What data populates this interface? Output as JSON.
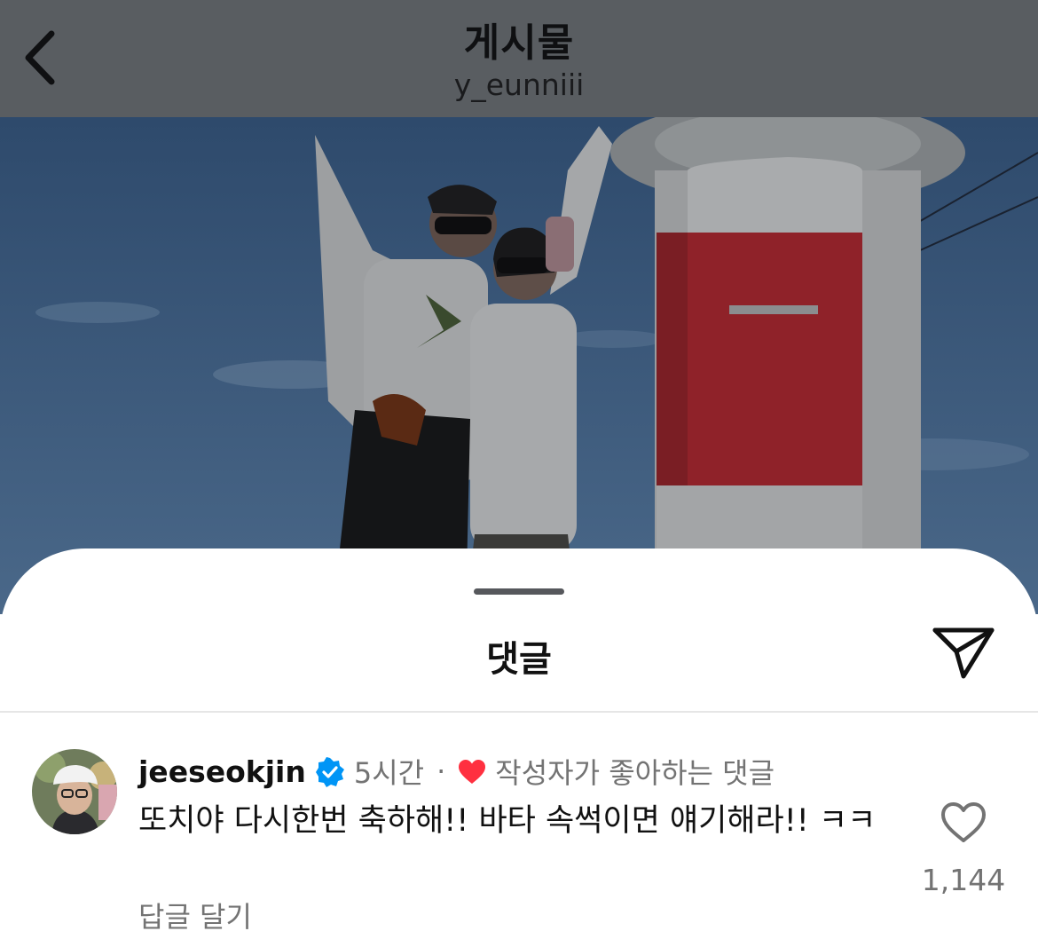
{
  "header": {
    "title": "게시물",
    "username": "y_eunniii",
    "back_icon": "chevron-left-icon"
  },
  "photo": {
    "description_icon": "post-photo",
    "dim_overlay": "#000000"
  },
  "sheet": {
    "title": "댓글",
    "share_icon": "paper-plane-icon"
  },
  "comment": {
    "username": "jeeseokjin",
    "verified_icon": "verified-badge-icon",
    "time": "5시간",
    "separator": "·",
    "author_like_icon": "red-heart-icon",
    "liked_by_author_label": "작성자가 좋아하는 댓글",
    "text": "또치야 다시한번 축하해!! 바타 속썩이면 얘기해라!! ㅋㅋ",
    "reply_label": "답글 달기",
    "like_icon": "heart-outline-icon",
    "like_count": "1,144"
  },
  "colors": {
    "header_dimmed": "#595d61",
    "verified_blue": "#0095f6",
    "heart_red": "#ff3040",
    "secondary_text": "#737373"
  }
}
